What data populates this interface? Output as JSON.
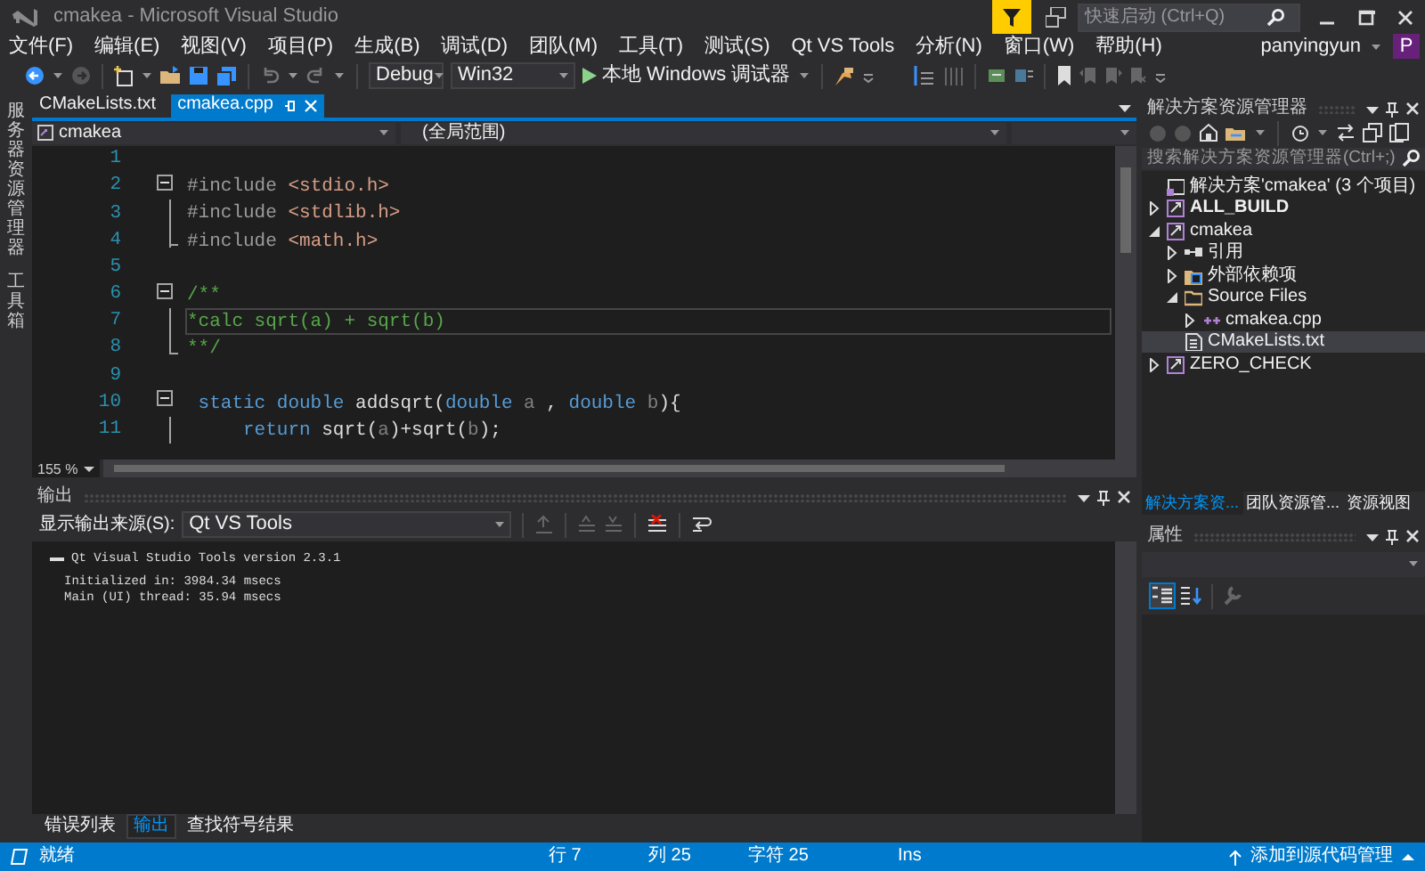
{
  "window": {
    "title": "cmakea - Microsoft Visual Studio"
  },
  "quick_launch": {
    "placeholder": "快速启动 (Ctrl+Q)"
  },
  "menu": [
    "文件(F)",
    "编辑(E)",
    "视图(V)",
    "项目(P)",
    "生成(B)",
    "调试(D)",
    "团队(M)",
    "工具(T)",
    "测试(S)",
    "Qt VS Tools",
    "分析(N)",
    "窗口(W)",
    "帮助(H)"
  ],
  "user": {
    "name": "panyingyun",
    "avatar_letter": "P"
  },
  "toolbar": {
    "configuration": "Debug",
    "platform": "Win32",
    "run_label": "本地 Windows 调试器"
  },
  "left_rail": [
    "服务器资源管理器",
    "工具箱"
  ],
  "editor": {
    "tabs": [
      {
        "label": "CMakeLists.txt",
        "selected": false
      },
      {
        "label": "cmakea.cpp",
        "selected": true
      }
    ],
    "project_dropdown": "cmakea",
    "scope_dropdown": "(全局范围)",
    "zoom": "155 %",
    "lines": [
      {
        "number": "1",
        "collapsible": false,
        "in_block": false,
        "block_end": false,
        "current": false
      },
      {
        "number": "2",
        "collapsible": true,
        "in_block": false,
        "block_end": false,
        "current": false,
        "tokens": [
          {
            "kind": "preprocessor",
            "text": "#include "
          },
          {
            "kind": "string",
            "text": "<stdio.h>"
          }
        ]
      },
      {
        "number": "3",
        "collapsible": false,
        "in_block": true,
        "block_end": false,
        "current": false,
        "tokens": [
          {
            "kind": "preprocessor",
            "text": "#include "
          },
          {
            "kind": "string",
            "text": "<stdlib.h>"
          }
        ]
      },
      {
        "number": "4",
        "collapsible": false,
        "in_block": true,
        "block_end": true,
        "current": false,
        "tokens": [
          {
            "kind": "preprocessor",
            "text": "#include "
          },
          {
            "kind": "string",
            "text": "<math.h>"
          }
        ]
      },
      {
        "number": "5",
        "collapsible": false,
        "in_block": false,
        "block_end": false,
        "current": false
      },
      {
        "number": "6",
        "collapsible": true,
        "in_block": false,
        "block_end": false,
        "current": false,
        "tokens": [
          {
            "kind": "comment",
            "text": "/**"
          }
        ]
      },
      {
        "number": "7",
        "collapsible": false,
        "in_block": true,
        "block_end": false,
        "current": true,
        "tokens": [
          {
            "kind": "comment",
            "text": "*calc sqrt(a) + sqrt(b)"
          }
        ]
      },
      {
        "number": "8",
        "collapsible": false,
        "in_block": true,
        "block_end": true,
        "current": false,
        "tokens": [
          {
            "kind": "comment",
            "text": "**/"
          }
        ]
      },
      {
        "number": "9",
        "collapsible": false,
        "in_block": false,
        "block_end": false,
        "current": false
      },
      {
        "number": "10",
        "collapsible": true,
        "in_block": false,
        "block_end": false,
        "current": false,
        "tokens": [
          {
            "kind": "keyword",
            "text": " static double"
          },
          {
            "kind": "plain",
            "text": " addsqrt("
          },
          {
            "kind": "keyword",
            "text": "double"
          },
          {
            "kind": "param",
            "text": " a "
          },
          {
            "kind": "plain",
            "text": ", "
          },
          {
            "kind": "keyword",
            "text": "double"
          },
          {
            "kind": "param",
            "text": " b"
          },
          {
            "kind": "plain",
            "text": "){"
          }
        ]
      },
      {
        "number": "11",
        "collapsible": false,
        "in_block": true,
        "block_end": false,
        "current": false,
        "tokens": [
          {
            "kind": "keyword",
            "text": "     return"
          },
          {
            "kind": "plain",
            "text": " sqrt("
          },
          {
            "kind": "param",
            "text": "a"
          },
          {
            "kind": "plain",
            "text": ")+sqrt("
          },
          {
            "kind": "param",
            "text": "b"
          },
          {
            "kind": "plain",
            "text": ");"
          }
        ]
      }
    ]
  },
  "output": {
    "title": "输出",
    "source_label": "显示输出来源(S):",
    "source": "Qt VS Tools",
    "lines": [
      {
        "kind": "header",
        "text": "Qt Visual Studio Tools version 2.3.1"
      },
      {
        "kind": "detail",
        "text": "Initialized in: 3984.34 msecs"
      },
      {
        "kind": "detail",
        "text": "Main (UI) thread: 35.94 msecs"
      }
    ],
    "tabs": [
      {
        "label": "错误列表",
        "selected": false
      },
      {
        "label": "输出",
        "selected": true
      },
      {
        "label": "查找符号结果",
        "selected": false
      }
    ]
  },
  "solution_explorer": {
    "title": "解决方案资源管理器",
    "search_placeholder": "搜索解决方案资源管理器(Ctrl+;)",
    "tree": [
      {
        "label": "解决方案'cmakea' (3 个项目)",
        "kind": "solution",
        "expandable": false,
        "startup": false,
        "selected": false,
        "children": [
          {
            "label": "ALL_BUILD",
            "kind": "project",
            "expandable": true,
            "expanded": false,
            "startup": true,
            "selected": false
          },
          {
            "label": "cmakea",
            "kind": "project",
            "expandable": true,
            "expanded": true,
            "startup": false,
            "selected": false,
            "children": [
              {
                "label": "引用",
                "kind": "references",
                "expandable": true,
                "expanded": false,
                "startup": false,
                "selected": false
              },
              {
                "label": "外部依赖项",
                "kind": "dependencies",
                "expandable": true,
                "expanded": false,
                "startup": false,
                "selected": false
              },
              {
                "label": "Source Files",
                "kind": "folder",
                "expandable": true,
                "expanded": true,
                "startup": false,
                "selected": false,
                "children": [
                  {
                    "label": "cmakea.cpp",
                    "kind": "cpp",
                    "expandable": true,
                    "expanded": false,
                    "startup": false,
                    "selected": false
                  }
                ]
              },
              {
                "label": "CMakeLists.txt",
                "kind": "text",
                "expandable": false,
                "startup": false,
                "selected": true
              }
            ]
          },
          {
            "label": "ZERO_CHECK",
            "kind": "project",
            "expandable": true,
            "expanded": false,
            "startup": false,
            "selected": false
          }
        ]
      }
    ],
    "tabs": [
      {
        "label": "解决方案资...",
        "selected": true
      },
      {
        "label": "团队资源管...",
        "selected": false
      },
      {
        "label": "资源视图",
        "selected": false
      }
    ]
  },
  "properties": {
    "title": "属性"
  },
  "status_bar": {
    "state": "就绪",
    "line": "行 7",
    "column": "列 25",
    "char": "字符 25",
    "mode": "Ins",
    "source_control": "添加到源代码管理"
  }
}
